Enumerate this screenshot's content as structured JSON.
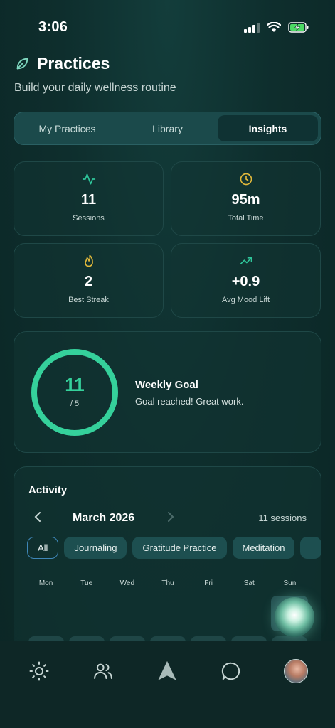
{
  "status_bar": {
    "time": "3:06"
  },
  "header": {
    "title": "Practices",
    "subtitle": "Build your daily wellness routine"
  },
  "tabs": [
    {
      "label": "My Practices",
      "active": false
    },
    {
      "label": "Library",
      "active": false
    },
    {
      "label": "Insights",
      "active": true
    }
  ],
  "stats": [
    {
      "icon": "activity-pulse-icon",
      "value": "11",
      "label": "Sessions",
      "color": "#2fc59a"
    },
    {
      "icon": "clock-icon",
      "value": "95m",
      "label": "Total Time",
      "color": "#e2b93b"
    },
    {
      "icon": "flame-icon",
      "value": "2",
      "label": "Best Streak",
      "color": "#e2b93b"
    },
    {
      "icon": "trending-up-icon",
      "value": "+0.9",
      "label": "Avg Mood Lift",
      "color": "#2fc59a"
    }
  ],
  "weekly_goal": {
    "completed": "11",
    "target": "/ 5",
    "progress_fraction": 1.0,
    "title": "Weekly Goal",
    "message": "Goal reached! Great work.",
    "accent": "#35d19b"
  },
  "activity": {
    "title": "Activity",
    "month": "March 2026",
    "sessions": "11 sessions",
    "filters": [
      {
        "label": "All",
        "active": true
      },
      {
        "label": "Journaling",
        "active": false
      },
      {
        "label": "Gratitude Practice",
        "active": false
      },
      {
        "label": "Meditation",
        "active": false
      }
    ],
    "weekdays": [
      "Mon",
      "Tue",
      "Wed",
      "Thu",
      "Fri",
      "Sat",
      "Sun"
    ]
  },
  "bottom_nav": [
    {
      "icon": "sun-icon"
    },
    {
      "icon": "people-icon"
    },
    {
      "icon": "navigation-arrow-icon"
    },
    {
      "icon": "chat-bubble-icon"
    },
    {
      "icon": "profile-avatar"
    }
  ]
}
